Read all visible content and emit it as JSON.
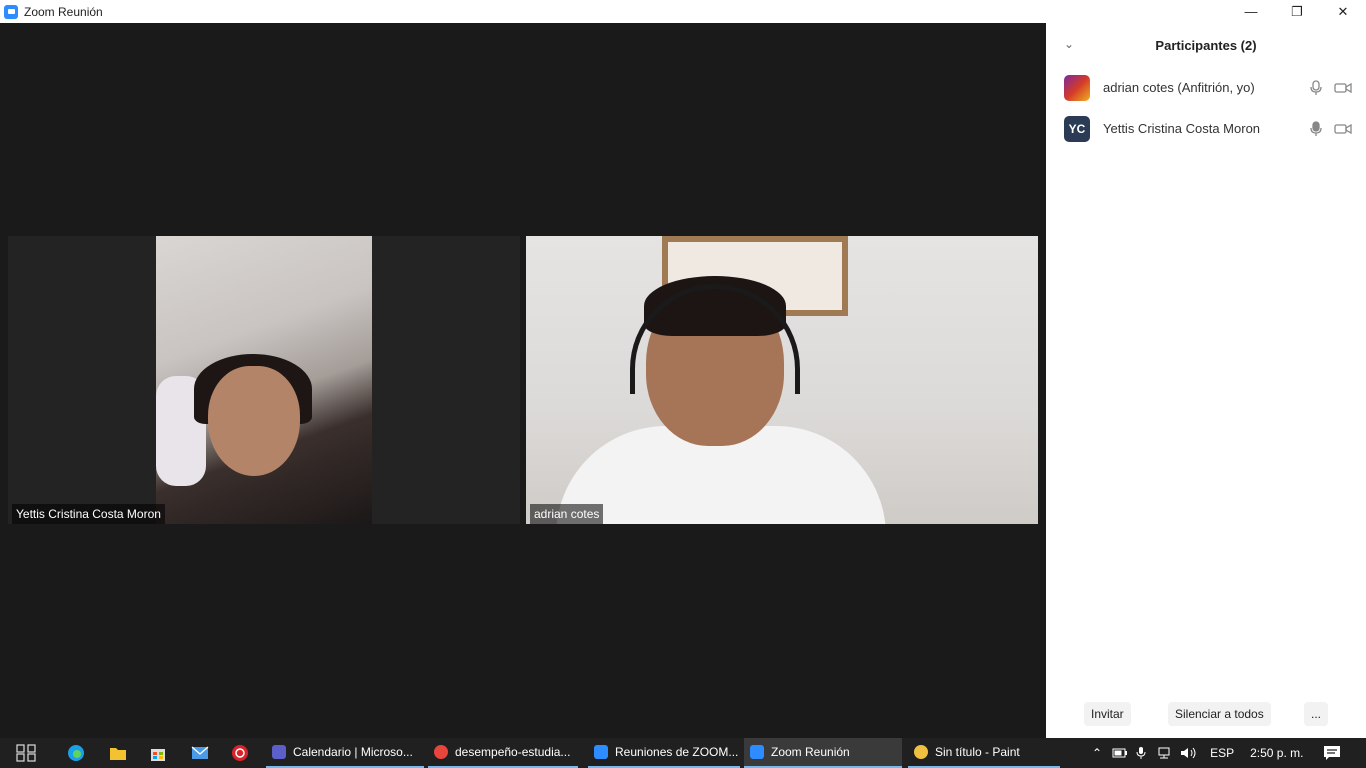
{
  "window": {
    "title": "Zoom Reunión",
    "minimize": "—",
    "restore": "❐",
    "close": "✕"
  },
  "meeting": {
    "participants_video": [
      {
        "name": "Yettis Cristina Costa Moron"
      },
      {
        "name": "adrian cotes"
      }
    ]
  },
  "panel": {
    "title": "Participantes (2)",
    "participants": [
      {
        "name": "adrian cotes (Anfitrión, yo)",
        "avatar": "image",
        "mic": "unmuted",
        "video": "off"
      },
      {
        "name": "Yettis Cristina Costa Moron",
        "avatar_initials": "YC",
        "mic": "unmuted",
        "video": "off"
      }
    ],
    "footer": {
      "invite": "Invitar",
      "mute_all": "Silenciar a todos",
      "more": "..."
    }
  },
  "taskbar": {
    "apps": [
      {
        "label": "Calendario | Microso...",
        "icon": "teams-icon",
        "color": "#5b5fc7"
      },
      {
        "label": "desempeño-estudia...",
        "icon": "chrome-icon",
        "color": "#e8453c"
      },
      {
        "label": "Reuniones de ZOOM...",
        "icon": "zoom-icon",
        "color": "#2d8cff"
      },
      {
        "label": "Zoom Reunión",
        "icon": "zoom-icon",
        "color": "#2d8cff",
        "active": true
      },
      {
        "label": "Sin título - Paint",
        "icon": "paint-icon",
        "color": "#f0c040"
      }
    ],
    "language": "ESP",
    "time": "2:50 p. m."
  }
}
